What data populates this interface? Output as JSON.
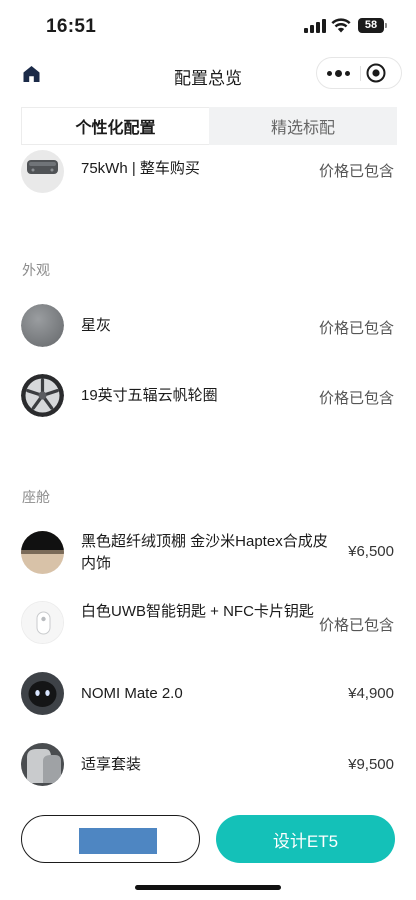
{
  "status_bar": {
    "time": "16:51",
    "battery": "58",
    "icons": [
      "signal-icon",
      "wifi-icon",
      "battery-icon"
    ]
  },
  "nav": {
    "title": "配置总览",
    "icons": [
      "home-icon",
      "more-icon",
      "close-mini-program-icon"
    ]
  },
  "tabs": [
    {
      "label": "个性化配置",
      "active": true
    },
    {
      "label": "精选标配",
      "active": false
    }
  ],
  "sections": {
    "battery": {
      "items": [
        {
          "label": "75kWh | 整车购买",
          "price": "价格已包含"
        }
      ]
    },
    "exterior": {
      "title": "外观",
      "items": [
        {
          "label": "星灰",
          "price": "价格已包含"
        },
        {
          "label": "19英寸五辐云帆轮圈",
          "price": "价格已包含"
        }
      ]
    },
    "cabin": {
      "title": "座舱",
      "items": [
        {
          "label": "黑色超纤绒顶棚 金沙米Haptex合成皮内饰",
          "price": "¥6,500"
        },
        {
          "label": "白色UWB智能钥匙 + NFC卡片钥匙",
          "price": "价格已包含"
        },
        {
          "label": "NOMI Mate 2.0",
          "price": "¥4,900"
        },
        {
          "label": "适享套装",
          "price": "¥9,500"
        }
      ]
    }
  },
  "footer": {
    "primary_button": "设计ET5"
  },
  "colors": {
    "accent": "#14c1b8",
    "text": "#1b1b1b",
    "section_title": "#8c8c8c",
    "tab_background": "#f1f2f3",
    "redaction": "#4e86c2"
  }
}
